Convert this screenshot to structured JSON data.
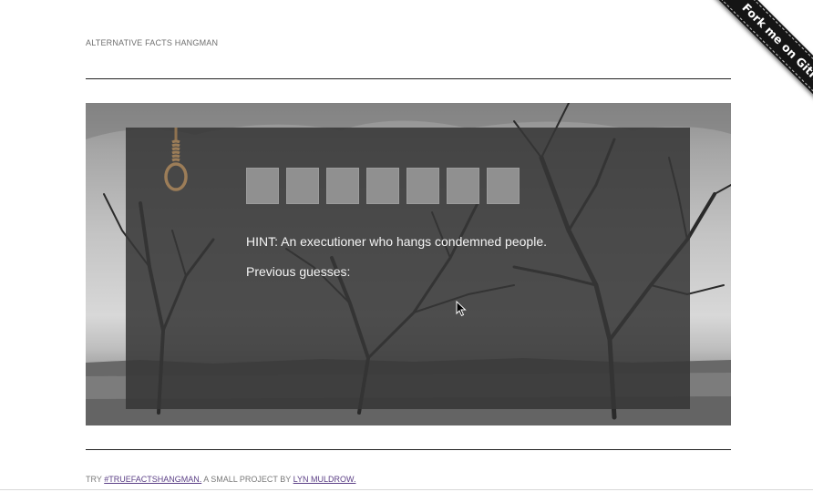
{
  "header": {
    "title": "ALTERNATIVE FACTS HANGMAN"
  },
  "ribbon": {
    "label": "Fork me on GitHub"
  },
  "game": {
    "tile_count": 7,
    "hint_text": "HINT: An executioner who hangs condemned people.",
    "previous_guesses_label": "Previous guesses:",
    "previous_guesses": []
  },
  "footer": {
    "prefix": "TRY",
    "hashtag_link": "#TRUEFACTSHANGMAN.",
    "middle": "A SMALL PROJECT BY",
    "author_link": "LYN MULDROW."
  },
  "colors": {
    "panel_overlay": "#353535",
    "tile": "#909090",
    "link": "#5b3f86",
    "ribbon": "#151515"
  },
  "icons": {
    "hero": "dead-trees-photo",
    "noose": "noose-icon",
    "cursor": "mouse-cursor-icon"
  }
}
